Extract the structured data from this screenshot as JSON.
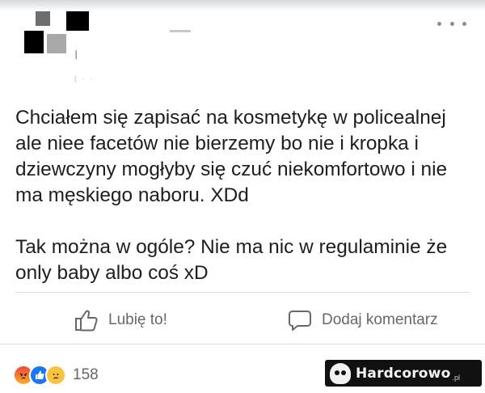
{
  "post": {
    "author": "I",
    "paragraphs": [
      "Chciałem się zapisać na kosmetykę w policealnej ale niee facetów nie bierzemy bo nie i kropka i dziewczyny mogłyby się czuć niekomfortowo i nie ma męskiego naboru. XDd",
      "Tak można w ogóle? Nie ma nic w regulaminie że only baby albo coś xD"
    ]
  },
  "actions": {
    "like_label": "Lubię to!",
    "comment_label": "Dodaj komentarz"
  },
  "reactions": {
    "count": "158",
    "types": [
      "angry-icon",
      "like-icon",
      "sad-icon"
    ]
  },
  "watermark": {
    "text": "Hardcorowo",
    "tld": ".pl"
  },
  "colors": {
    "text": "#1c1e21",
    "secondary": "#65676b",
    "like_blue": "#1877f2"
  }
}
